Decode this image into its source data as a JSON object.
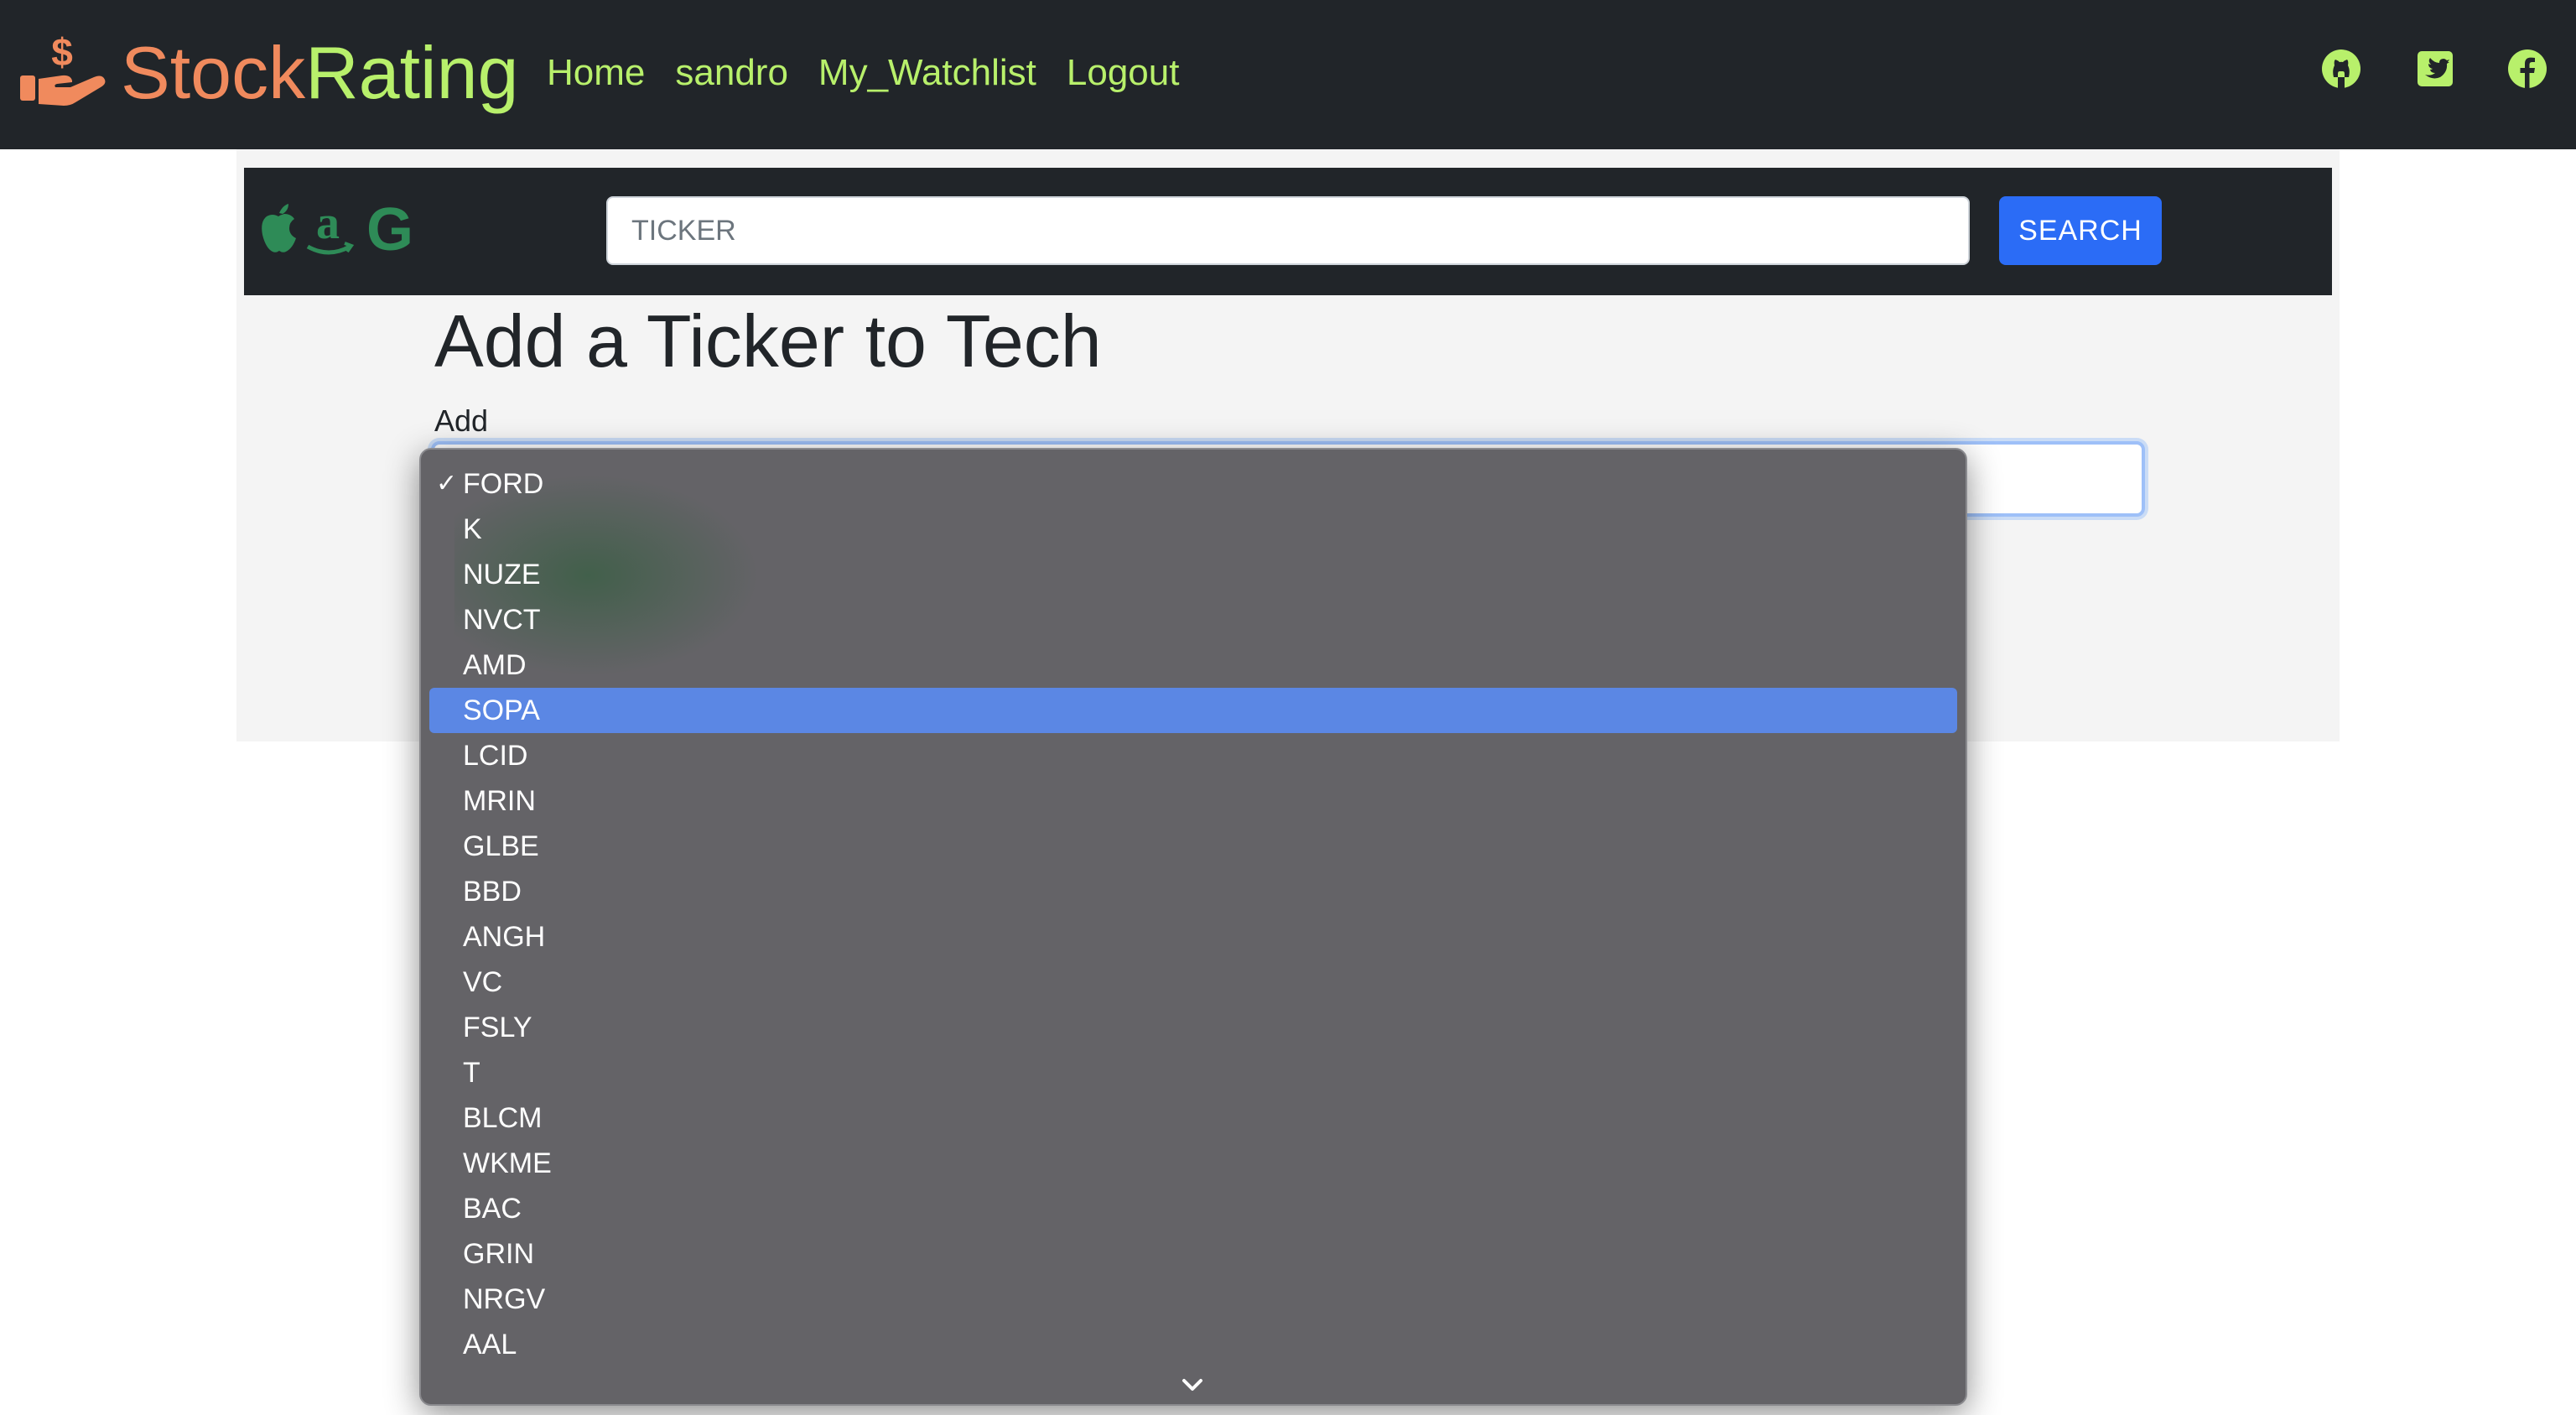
{
  "navbar": {
    "brand_part1": "Stock",
    "brand_part2": "Rating",
    "links": [
      "Home",
      "sandro",
      "My_Watchlist",
      "Logout"
    ],
    "social_icons": [
      "github-icon",
      "twitter-icon",
      "facebook-icon"
    ]
  },
  "search": {
    "placeholder": "TICKER",
    "button_label": "SEARCH",
    "logo_icons": [
      "apple-icon",
      "amazon-icon",
      "google-icon"
    ]
  },
  "main": {
    "title": "Add a Ticker to Tech",
    "field_label": "Add"
  },
  "dropdown": {
    "checked_option": "FORD",
    "highlighted_option": "SOPA",
    "options": [
      "FORD",
      "K",
      "NUZE",
      "NVCT",
      "AMD",
      "SOPA",
      "LCID",
      "MRIN",
      "GLBE",
      "BBD",
      "ANGH",
      "VC",
      "FSLY",
      "T",
      "BLCM",
      "WKME",
      "BAC",
      "GRIN",
      "NRGV",
      "AAL"
    ]
  },
  "colors": {
    "navbar_bg": "#212529",
    "brand_orange": "#f08a5d",
    "accent_green": "#b8f06b",
    "search_button": "#2b6cf6",
    "dropdown_bg": "#646367",
    "dropdown_highlight": "#5b87e4"
  }
}
